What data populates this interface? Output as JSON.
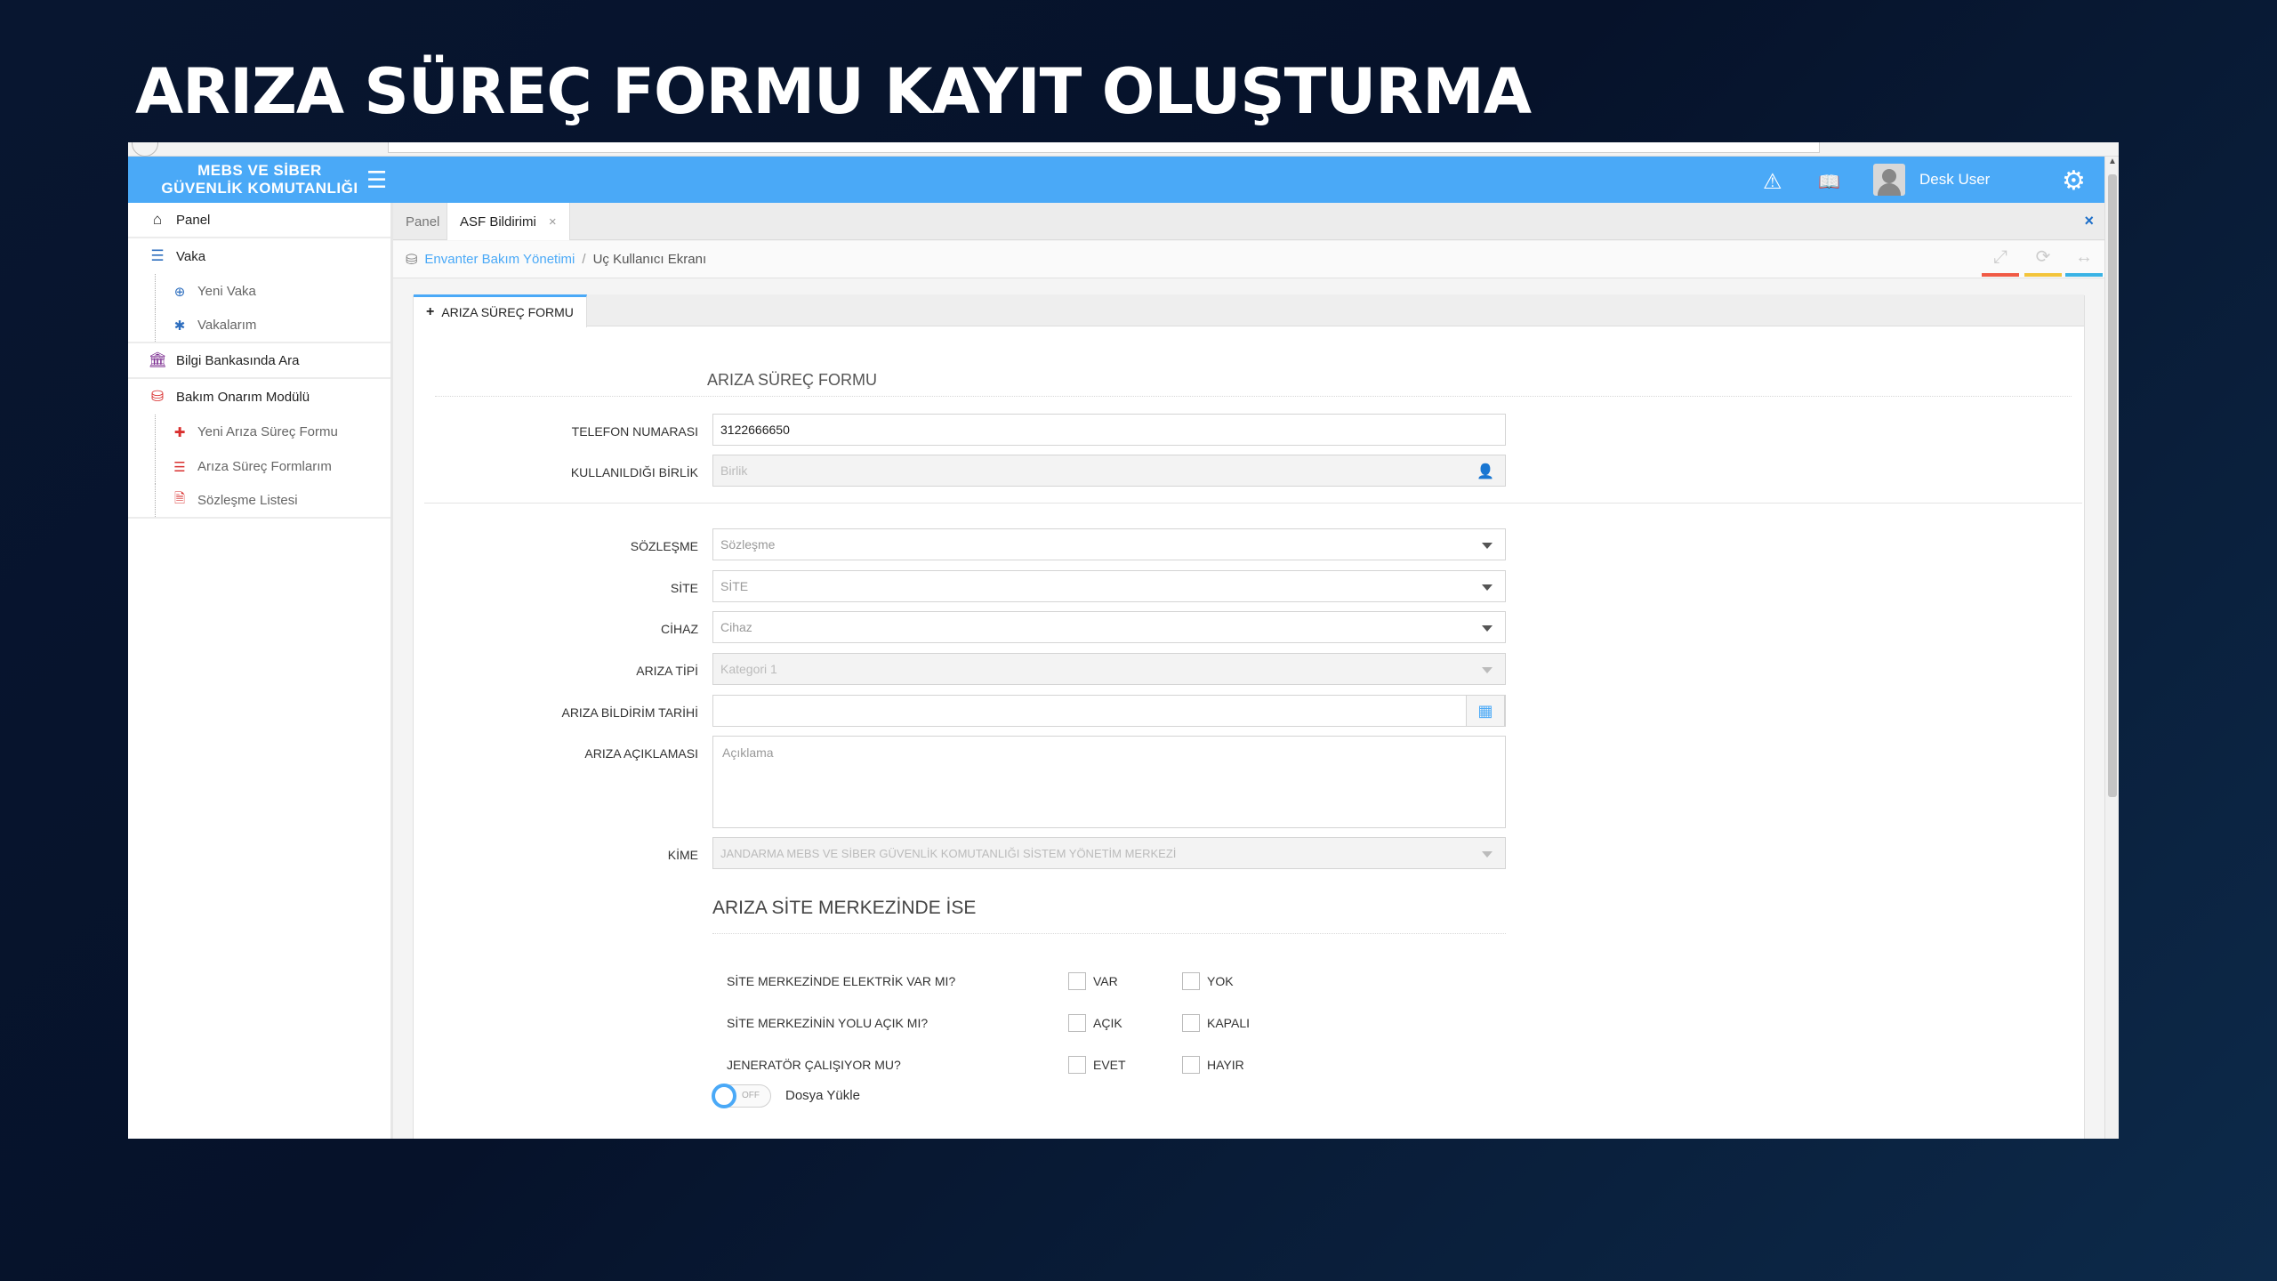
{
  "slide": {
    "title": "ARIZA SÜREÇ FORMU KAYIT OLUŞTURMA"
  },
  "header": {
    "brand_line1": "MEBS VE SİBER",
    "brand_line2": "GÜVENLİK KOMUTANLIĞI",
    "user_name": "Desk User",
    "icons": [
      "menu-icon",
      "warning-icon",
      "book-icon",
      "avatar",
      "gear-icon"
    ],
    "accent": "#4aa9f7"
  },
  "sidebar": {
    "items": [
      {
        "label": "Panel",
        "icon": "home-icon"
      },
      {
        "label": "Vaka",
        "icon": "list-icon"
      },
      {
        "label": "Yeni Vaka",
        "icon": "plus-circle-icon"
      },
      {
        "label": "Vakalarım",
        "icon": "asterisk-icon"
      },
      {
        "label": "Bilgi Bankasında Ara",
        "icon": "bank-icon"
      },
      {
        "label": "Bakım Onarım Modülü",
        "icon": "database-icon"
      },
      {
        "label": "Yeni Arıza Süreç Formu",
        "icon": "plus-icon"
      },
      {
        "label": "Arıza Süreç Formlarım",
        "icon": "list-icon"
      },
      {
        "label": "Sözleşme Listesi",
        "icon": "file-icon"
      }
    ]
  },
  "tabs": [
    {
      "label": "Panel"
    },
    {
      "label": "ASF Bildirimi",
      "close": "×"
    }
  ],
  "close_all": "×",
  "breadcrumb": {
    "link": "Envanter Bakım Yönetimi",
    "sep": "/",
    "current": "Uç Kullanıcı Ekranı"
  },
  "panel_tab": {
    "plus": "+",
    "label": "ARIZA SÜREÇ FORMU"
  },
  "form": {
    "title": "ARIZA SÜREÇ FORMU",
    "phone": {
      "label": "TELEFON NUMARASI",
      "value": "3122666650"
    },
    "unit": {
      "label": "KULLANILDIĞI BİRLİK",
      "placeholder": "Birlik"
    },
    "contract": {
      "label": "SÖZLEŞME",
      "placeholder": "Sözleşme"
    },
    "site": {
      "label": "SİTE",
      "placeholder": "SİTE"
    },
    "device": {
      "label": "CİHAZ",
      "placeholder": "Cihaz"
    },
    "fault_type": {
      "label": "ARIZA TİPİ",
      "placeholder": "Kategori 1"
    },
    "report_date": {
      "label": "ARIZA BİLDİRİM TARİHİ",
      "value": ""
    },
    "description": {
      "label": "ARIZA AÇIKLAMASI",
      "placeholder": "Açıklama"
    },
    "to": {
      "label": "KİME",
      "value": "JANDARMA MEBS VE SİBER GÜVENLİK KOMUTANLIĞI SİSTEM YÖNETİM MERKEZİ"
    }
  },
  "site_section": {
    "title": "ARIZA SİTE MERKEZİNDE İSE",
    "questions": [
      {
        "label": "SİTE MERKEZİNDE ELEKTRİK VAR MI?",
        "opt1": "VAR",
        "opt2": "YOK"
      },
      {
        "label": "SİTE MERKEZİNİN YOLU AÇIK MI?",
        "opt1": "AÇIK",
        "opt2": "KAPALI"
      },
      {
        "label": "JENERATÖR ÇALIŞIYOR MU?",
        "opt1": "EVET",
        "opt2": "HAYIR"
      }
    ],
    "upload_toggle": {
      "state": "OFF",
      "label": "Dosya Yükle"
    }
  }
}
